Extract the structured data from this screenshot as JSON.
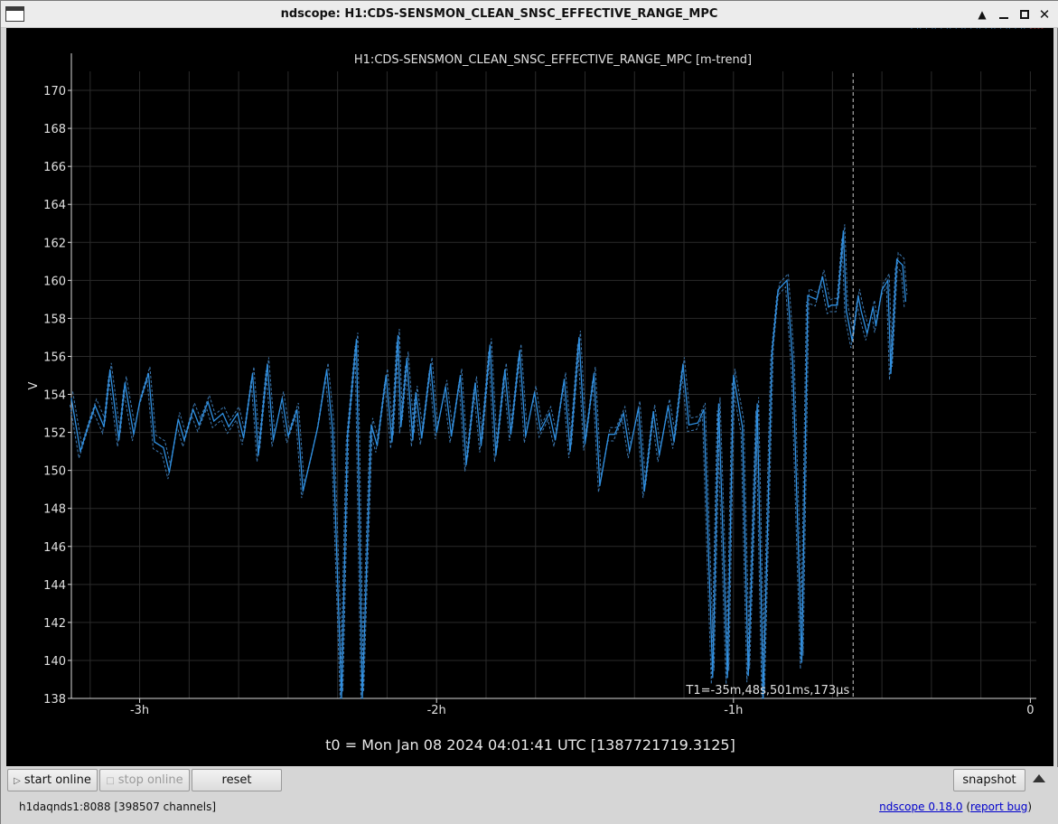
{
  "window": {
    "title": "ndscope: H1:CDS-SENSMON_CLEAN_SNSC_EFFECTIVE_RANGE_MPC",
    "controls": {
      "up": "▲",
      "close": "✕"
    }
  },
  "plot": {
    "cursor_label": "T1=-35m,48s,501ms,173µs",
    "t0_label": "t0 = Mon Jan 08 2024 04:01:41 UTC [1387721719.3125]"
  },
  "chart_data": {
    "type": "line",
    "title": "H1:CDS-SENSMON_CLEAN_SNSC_EFFECTIVE_RANGE_MPC [m-trend]",
    "xlabel": "",
    "ylabel": "V",
    "xticks": [
      "-3h",
      "-2h",
      "-1h",
      "0"
    ],
    "xlim_hours": [
      -3.23,
      0.02
    ],
    "ylim": [
      138,
      171
    ],
    "yticks": [
      138,
      140,
      142,
      144,
      146,
      148,
      150,
      152,
      154,
      156,
      158,
      160,
      162,
      164,
      166,
      168,
      170
    ],
    "grid": true,
    "cursor_x_hours": -0.597,
    "colors": {
      "mean": "#2f8fe0",
      "minmax": "#3c78b0",
      "cursor": "#c8c8c8",
      "axis": "#d8d8d8",
      "grid": "#2a2a2a"
    },
    "x_hours": [
      -3.23,
      -3.2,
      -3.17,
      -3.15,
      -3.12,
      -3.1,
      -3.07,
      -3.05,
      -3.02,
      -3.0,
      -2.97,
      -2.95,
      -2.92,
      -2.9,
      -2.87,
      -2.85,
      -2.82,
      -2.8,
      -2.77,
      -2.75,
      -2.72,
      -2.7,
      -2.67,
      -2.65,
      -2.62,
      -2.6,
      -2.57,
      -2.55,
      -2.52,
      -2.5,
      -2.47,
      -2.45,
      -2.42,
      -2.4,
      -2.37,
      -2.35,
      -2.32,
      -2.3,
      -2.27,
      -2.25,
      -2.22,
      -2.2,
      -2.17,
      -2.15,
      -2.13,
      -2.12,
      -2.1,
      -2.08,
      -2.07,
      -2.05,
      -2.02,
      -2.0,
      -1.97,
      -1.95,
      -1.92,
      -1.9,
      -1.87,
      -1.85,
      -1.82,
      -1.8,
      -1.77,
      -1.75,
      -1.72,
      -1.7,
      -1.67,
      -1.65,
      -1.62,
      -1.6,
      -1.57,
      -1.55,
      -1.52,
      -1.5,
      -1.47,
      -1.45,
      -1.42,
      -1.4,
      -1.37,
      -1.35,
      -1.32,
      -1.3,
      -1.27,
      -1.25,
      -1.22,
      -1.2,
      -1.17,
      -1.15,
      -1.12,
      -1.1,
      -1.07,
      -1.05,
      -1.02,
      -1.0,
      -0.97,
      -0.95,
      -0.92,
      -0.9,
      -0.87,
      -0.85,
      -0.82,
      -0.8,
      -0.77,
      -0.75,
      -0.72,
      -0.7,
      -0.68,
      -0.67,
      -0.65,
      -0.63,
      -0.62,
      -0.6,
      -0.58,
      -0.57,
      -0.55,
      -0.53,
      -0.52,
      -0.5,
      -0.48,
      -0.47,
      -0.45,
      -0.43,
      -0.42,
      -0.4,
      -0.38,
      -0.37,
      -0.35,
      -0.33,
      -0.32,
      -0.3,
      -0.28,
      -0.27,
      -0.25,
      -0.23,
      -0.22,
      -0.2,
      -0.18,
      -0.17,
      -0.15,
      -0.13,
      -0.12,
      -0.1,
      -0.08,
      -0.07,
      -0.05,
      -0.03,
      -0.02,
      0.0
    ],
    "series": [
      {
        "values": [
          153.8,
          151.0,
          152.5,
          153.4,
          152.3,
          155.3,
          151.6,
          154.6,
          151.9,
          153.6,
          155.1,
          151.5,
          151.2,
          149.9,
          152.7,
          151.6,
          153.2,
          152.4,
          153.6,
          152.6,
          153.0,
          152.3,
          153.0,
          151.7,
          155.1,
          150.8,
          155.6,
          151.6,
          153.8,
          151.8,
          153.2,
          148.9,
          150.9,
          152.3,
          155.3,
          152.1,
          138.0,
          151.8,
          156.9,
          138.0,
          152.4,
          151.3,
          155.0,
          151.5,
          157.1,
          152.3,
          155.9,
          151.6,
          154.1,
          151.7,
          155.6,
          152.0,
          154.4,
          151.8,
          155.0,
          150.3,
          154.6,
          151.3,
          156.6,
          150.8,
          155.3,
          151.9,
          156.3,
          151.8,
          154.1,
          152.1,
          153.0,
          151.6,
          154.8,
          151.0,
          157.0,
          151.4,
          155.1,
          149.2,
          151.9,
          151.9,
          153.0,
          151.0,
          153.3,
          148.9,
          153.1,
          150.8,
          153.4,
          151.5,
          155.6,
          152.4,
          152.5,
          153.2,
          139.1,
          153.5,
          139.1,
          155.0,
          152.3,
          139.2,
          153.5,
          138.0,
          156.2,
          159.5,
          160.0,
          155.6,
          139.9,
          159.2,
          159.0,
          160.2,
          158.6,
          158.7,
          158.7,
          162.6,
          158.4,
          156.8,
          159.2,
          158.4,
          157.2,
          158.6,
          157.6,
          159.5,
          160.0,
          155.1,
          161.1,
          160.8,
          158.9
        ]
      }
    ]
  }
}
